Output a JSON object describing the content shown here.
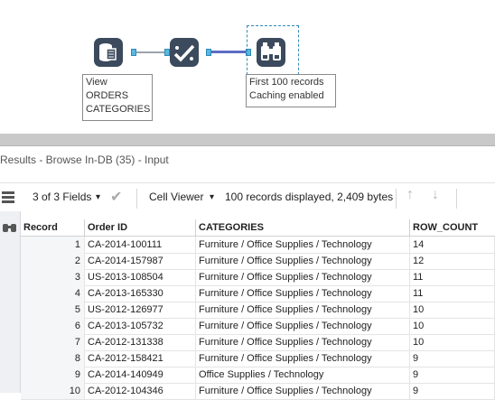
{
  "canvas": {
    "annotations": {
      "input": "View\nORDERS\nCATEGORIES",
      "browse": "First 100 records\nCaching enabled"
    }
  },
  "results": {
    "title": "Results - Browse In-DB (35) - Input",
    "fields_label": "3 of 3 Fields",
    "cell_viewer_label": "Cell Viewer",
    "summary": "100 records displayed, 2,409 bytes"
  },
  "table": {
    "columns": [
      "Record",
      "Order ID",
      "CATEGORIES",
      "ROW_COUNT"
    ],
    "rows": [
      {
        "record": "1",
        "order_id": "CA-2014-100111",
        "categories": "Furniture / Office Supplies / Technology",
        "row_count": "14"
      },
      {
        "record": "2",
        "order_id": "CA-2014-157987",
        "categories": "Furniture / Office Supplies / Technology",
        "row_count": "12"
      },
      {
        "record": "3",
        "order_id": "US-2013-108504",
        "categories": "Furniture / Office Supplies / Technology",
        "row_count": "11"
      },
      {
        "record": "4",
        "order_id": "CA-2013-165330",
        "categories": "Furniture / Office Supplies / Technology",
        "row_count": "11"
      },
      {
        "record": "5",
        "order_id": "US-2012-126977",
        "categories": "Furniture / Office Supplies / Technology",
        "row_count": "10"
      },
      {
        "record": "6",
        "order_id": "CA-2013-105732",
        "categories": "Furniture / Office Supplies / Technology",
        "row_count": "10"
      },
      {
        "record": "7",
        "order_id": "CA-2012-131338",
        "categories": "Furniture / Office Supplies / Technology",
        "row_count": "10"
      },
      {
        "record": "8",
        "order_id": "CA-2012-158421",
        "categories": "Furniture / Office Supplies / Technology",
        "row_count": "9"
      },
      {
        "record": "9",
        "order_id": "CA-2014-140949",
        "categories": "Office Supplies / Technology",
        "row_count": "9"
      },
      {
        "record": "10",
        "order_id": "CA-2012-104346",
        "categories": "Furniture / Office Supplies / Technology",
        "row_count": "9"
      }
    ]
  },
  "icons": {
    "input_tool": "database-input-icon",
    "summarize_tool": "checkmark-tool-icon",
    "browse_tool": "binoculars-icon",
    "list": "list-icon",
    "sidebar_browse": "binoculars-icon"
  },
  "colors": {
    "tool_body": "#3b4a5c",
    "anchor": "#58b8e0",
    "selected_connection": "#5c6cc4"
  }
}
